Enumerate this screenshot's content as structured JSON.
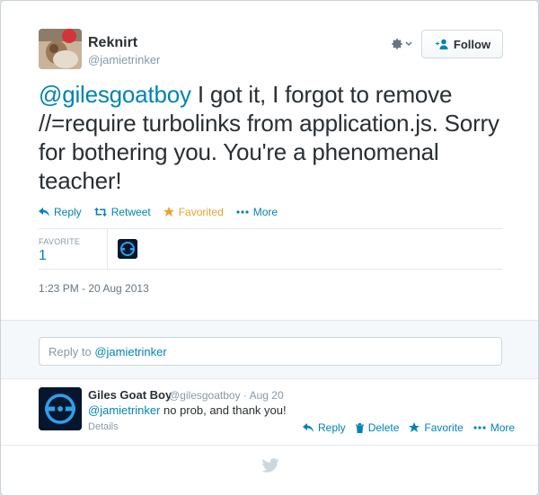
{
  "tweet": {
    "author_name": "Reknirt",
    "author_handle": "@jamietrinker",
    "follow_label": "Follow",
    "mention": "@gilesgoatboy",
    "text": " I got it, I forgot to remove //=require turbolinks from application.js. Sorry for bothering you. You're a phenomenal teacher!",
    "actions": {
      "reply": "Reply",
      "retweet": "Retweet",
      "favorited": "Favorited",
      "more": "More"
    },
    "stats": {
      "favorite_label": "FAVORITE",
      "favorite_count": "1"
    },
    "timestamp": "1:23 PM - 20 Aug 2013"
  },
  "reply_box": {
    "prefix": "Reply to ",
    "mention": "@jamietrinker"
  },
  "reply": {
    "author_name": "Giles Goat Boy",
    "author_handle": "@gilesgoatboy",
    "separator": "·",
    "date": "Aug 20",
    "mention": "@jamietrinker",
    "text": " no prob, and thank you!",
    "details": "Details",
    "actions": {
      "reply": "Reply",
      "delete": "Delete",
      "favorite": "Favorite",
      "more": "More"
    }
  },
  "colors": {
    "link": "#0084b4",
    "favorited": "#e8a32b",
    "muted": "#8899a6",
    "bird": "#ccd6dd"
  }
}
